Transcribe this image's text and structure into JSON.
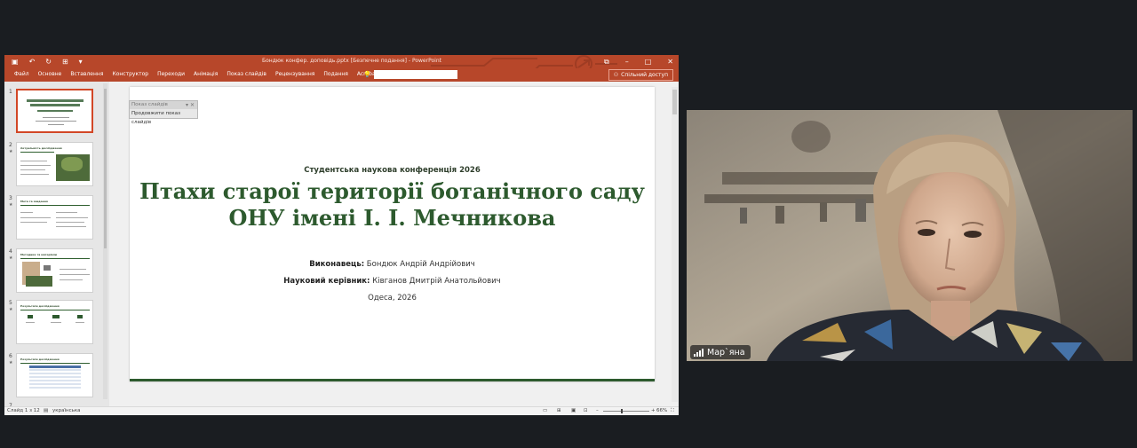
{
  "window": {
    "doc_title": "Бондюк конфер. доповідь.pptx [Безпечне подання] - PowerPoint",
    "qat_icons": [
      "save-icon",
      "undo-icon",
      "redo-icon",
      "slideshow-icon",
      "qat-more-icon"
    ],
    "window_controls": [
      "restore-icon",
      "minimize-icon",
      "maximize-icon",
      "close-icon"
    ]
  },
  "ribbon": {
    "tabs": [
      "Файл",
      "Основне",
      "Вставлення",
      "Конструктор",
      "Переходи",
      "Анімація",
      "Показ слайдів",
      "Рецензування",
      "Подання",
      "Acrobat"
    ],
    "tell_me_placeholder": "",
    "share_label": "Спільний доступ"
  },
  "thumbnails": [
    {
      "num": "1",
      "title": "Птахи старої території ботанічного саду",
      "active": true
    },
    {
      "num": "2",
      "title": "Актуальність дослідження",
      "active": false
    },
    {
      "num": "3",
      "title": "Мета та завдання",
      "active": false
    },
    {
      "num": "4",
      "title": "Методика та матеріали",
      "active": false
    },
    {
      "num": "5",
      "title": "Результати дослідження",
      "active": false
    },
    {
      "num": "6",
      "title": "Результати дослідження",
      "active": false
    },
    {
      "num": "7",
      "title": "",
      "active": false
    }
  ],
  "slideshow_panel": {
    "header": "Показ слайдів",
    "resume_label": "Продовжити показ слайдів"
  },
  "slide": {
    "conference": "Студентська наукова конференція 2026",
    "title_line1": "Птахи старої території ботанічного саду",
    "title_line2": "ОНУ імені І. І. Мечникова",
    "author_label": "Виконавець:",
    "author_name": "Бондюк Андрій Андрійович",
    "advisor_label": "Науковий керівник:",
    "advisor_name": "Ківганов Дмитрій Анатольйович",
    "city_year": "Одеса, 2026"
  },
  "status": {
    "slide_counter": "Слайд 1 з 12",
    "language": "українська",
    "zoom": "66%"
  },
  "video": {
    "participant_name": "Мар`яна"
  },
  "colors": {
    "ppt_accent": "#b7472a",
    "slide_green": "#2d5a2e",
    "meeting_bg": "#1a1d21"
  }
}
